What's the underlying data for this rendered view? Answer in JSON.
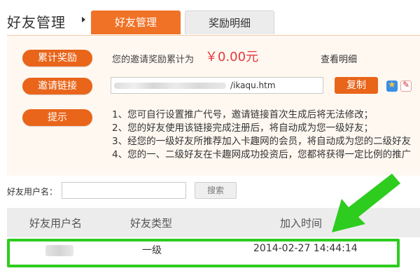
{
  "header": {
    "title": "好友管理",
    "tabs": [
      {
        "label": "好友管理",
        "active": true
      },
      {
        "label": "奖励明细",
        "active": false
      }
    ]
  },
  "reward": {
    "label": "累计奖励",
    "text": "您的邀请奖励累计为",
    "amount": "￥0.00元",
    "view_detail": "查看明细"
  },
  "invite": {
    "label": "邀请链接",
    "link_suffix": "/ikaqu.htm",
    "copy_label": "复制"
  },
  "tips": {
    "label": "提示",
    "lines": [
      "1、您可自行设置推广代号，邀请链接首次生成后将无法修改；",
      "2、您的好友使用该链接完成注册后，将自动成为您一级好友；",
      "3、经您的一级好友所推荐加入卡趣网的会员，将自动成为您的二级好友",
      "4、您的一、二级好友在卡趣网成功投资后，您都将获得一定比例的推广"
    ]
  },
  "search": {
    "label": "好友用户名：",
    "value": "",
    "button": "搜索"
  },
  "table": {
    "headers": [
      "好友用户名",
      "好友类型",
      "加入时间"
    ],
    "rows": [
      {
        "type": "一级",
        "time": "2014-02-27 14:44:14"
      }
    ]
  },
  "colors": {
    "accent": "#f07226",
    "highlight": "#2ecc1f",
    "amount": "#e4393c"
  }
}
